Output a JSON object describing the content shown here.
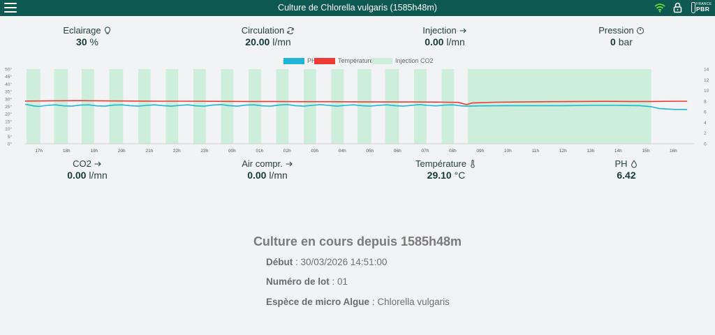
{
  "header": {
    "title": "Culture de Chlorella vulgaris (1585h48m)",
    "brand_top": "FRANCE",
    "brand_bottom": "PBR",
    "bg_color": "#0e5a52",
    "wifi_color": "#6ddc3a"
  },
  "metrics_top": [
    {
      "label": "Eclairage",
      "value": "30",
      "unit": "%",
      "icon": "bulb-icon"
    },
    {
      "label": "Circulation",
      "value": "20.00",
      "unit": "l/mn",
      "icon": "refresh-icon"
    },
    {
      "label": "Injection",
      "value": "0.00",
      "unit": "l/mn",
      "icon": "arrow-right-icon"
    },
    {
      "label": "Pression",
      "value": "0",
      "unit": "bar",
      "icon": "gauge-icon"
    }
  ],
  "metrics_bottom": [
    {
      "label": "CO2",
      "value": "0.00",
      "unit": "l/mn",
      "icon": "arrow-right-icon"
    },
    {
      "label": "Air compr.",
      "value": "0.00",
      "unit": "l/mn",
      "icon": "arrow-right-icon"
    },
    {
      "label": "Température",
      "value": "29.10",
      "unit": "°C",
      "icon": "thermometer-icon"
    },
    {
      "label": "PH",
      "value": "6.42",
      "unit": "",
      "icon": "drop-icon"
    }
  ],
  "chart_data": {
    "type": "line",
    "legend": [
      "PH",
      "Température",
      "Injection CO2"
    ],
    "colors": {
      "ph": "#1fb5d6",
      "temp": "#ee3a34",
      "co2": "#cdeedb"
    },
    "x_ticks": [
      "17h",
      "18h",
      "19h",
      "20h",
      "21h",
      "22h",
      "23h",
      "00h",
      "01h",
      "02h",
      "03h",
      "04h",
      "05h",
      "06h",
      "07h",
      "08h",
      "09h",
      "10h",
      "11h",
      "12h",
      "13h",
      "14h",
      "15h",
      "16h"
    ],
    "x_range": [
      16.5,
      40.75
    ],
    "y_left_ticks": [
      "0°",
      "5°",
      "10°",
      "15°",
      "20°",
      "25°",
      "30°",
      "35°",
      "40°",
      "45°",
      "50°"
    ],
    "y_left_range": [
      0,
      50
    ],
    "y_right_ticks": [
      "0",
      "2",
      "4",
      "6",
      "8",
      "10",
      "12",
      "14"
    ],
    "y_right_range": [
      0,
      14
    ],
    "co2_periods": [
      [
        16.55,
        17.05
      ],
      [
        17.55,
        18.05
      ],
      [
        18.55,
        19.0
      ],
      [
        19.55,
        20.05
      ],
      [
        20.6,
        21.05
      ],
      [
        21.6,
        22.05
      ],
      [
        22.6,
        23.05
      ],
      [
        23.6,
        24.05
      ],
      [
        24.6,
        25.05
      ],
      [
        25.6,
        26.05
      ],
      [
        26.6,
        27.05
      ],
      [
        27.6,
        28.05
      ],
      [
        28.55,
        29.05
      ],
      [
        29.55,
        30.05
      ],
      [
        30.6,
        31.05
      ],
      [
        31.6,
        32.05
      ],
      [
        32.55,
        39.2
      ]
    ],
    "temperature": [
      [
        16.5,
        28.6
      ],
      [
        17.5,
        28.8
      ],
      [
        18.5,
        28.9
      ],
      [
        19.5,
        28.7
      ],
      [
        20.5,
        28.6
      ],
      [
        21.5,
        28.5
      ],
      [
        22.5,
        28.5
      ],
      [
        23.5,
        28.4
      ],
      [
        24.5,
        28.3
      ],
      [
        25.5,
        28.3
      ],
      [
        26.5,
        28.2
      ],
      [
        27.5,
        28.2
      ],
      [
        28.5,
        28.1
      ],
      [
        29.5,
        28.0
      ],
      [
        30.5,
        28.0
      ],
      [
        31.5,
        27.9
      ],
      [
        32.2,
        27.7
      ],
      [
        32.5,
        26.2
      ],
      [
        32.7,
        27.3
      ],
      [
        33.5,
        27.8
      ],
      [
        34.5,
        28.0
      ],
      [
        35.5,
        28.2
      ],
      [
        36.5,
        28.3
      ],
      [
        37.5,
        28.4
      ],
      [
        38.5,
        28.3
      ],
      [
        39.2,
        28.3
      ],
      [
        39.6,
        28.4
      ],
      [
        40.5,
        28.5
      ]
    ],
    "ph": [
      [
        16.5,
        7.4
      ],
      [
        16.8,
        7.1
      ],
      [
        17.0,
        7.0
      ],
      [
        17.3,
        7.2
      ],
      [
        17.6,
        7.3
      ],
      [
        17.9,
        7.1
      ],
      [
        18.2,
        7.05
      ],
      [
        18.5,
        7.25
      ],
      [
        18.8,
        7.3
      ],
      [
        19.1,
        7.1
      ],
      [
        19.4,
        7.05
      ],
      [
        19.7,
        7.25
      ],
      [
        20.0,
        7.3
      ],
      [
        20.3,
        7.15
      ],
      [
        20.6,
        7.05
      ],
      [
        20.9,
        7.2
      ],
      [
        21.2,
        7.3
      ],
      [
        21.5,
        7.15
      ],
      [
        21.8,
        7.05
      ],
      [
        22.1,
        7.2
      ],
      [
        22.4,
        7.3
      ],
      [
        22.7,
        7.1
      ],
      [
        23.0,
        7.05
      ],
      [
        23.3,
        7.25
      ],
      [
        23.6,
        7.35
      ],
      [
        23.9,
        7.15
      ],
      [
        24.2,
        7.05
      ],
      [
        24.5,
        7.25
      ],
      [
        24.8,
        7.3
      ],
      [
        25.1,
        7.1
      ],
      [
        25.4,
        7.05
      ],
      [
        25.7,
        7.25
      ],
      [
        26.0,
        7.35
      ],
      [
        26.3,
        7.15
      ],
      [
        26.6,
        7.05
      ],
      [
        26.9,
        7.2
      ],
      [
        27.2,
        7.35
      ],
      [
        27.5,
        7.2
      ],
      [
        27.8,
        7.05
      ],
      [
        28.1,
        7.2
      ],
      [
        28.4,
        7.3
      ],
      [
        28.7,
        7.15
      ],
      [
        29.0,
        7.05
      ],
      [
        29.3,
        7.2
      ],
      [
        29.6,
        7.3
      ],
      [
        29.9,
        7.15
      ],
      [
        30.2,
        7.05
      ],
      [
        30.5,
        7.2
      ],
      [
        30.8,
        7.35
      ],
      [
        31.1,
        7.2
      ],
      [
        31.4,
        7.1
      ],
      [
        31.7,
        7.25
      ],
      [
        32.0,
        7.3
      ],
      [
        32.3,
        7.1
      ],
      [
        32.5,
        7.05
      ],
      [
        33.0,
        7.1
      ],
      [
        34.0,
        7.15
      ],
      [
        35.0,
        7.15
      ],
      [
        36.0,
        7.15
      ],
      [
        37.0,
        7.2
      ],
      [
        38.0,
        7.2
      ],
      [
        38.8,
        7.15
      ],
      [
        39.2,
        6.95
      ],
      [
        39.5,
        6.6
      ],
      [
        40.0,
        6.45
      ],
      [
        40.5,
        6.42
      ]
    ]
  },
  "culture": {
    "title": "Culture en cours depuis 1585h48m",
    "start_label": "Début",
    "start_value": "30/03/2026 14:51:00",
    "lot_label": "Numéro de lot",
    "lot_value": "01",
    "species_label": "Espèce de micro Algue",
    "species_value": "Chlorella vulgaris"
  }
}
